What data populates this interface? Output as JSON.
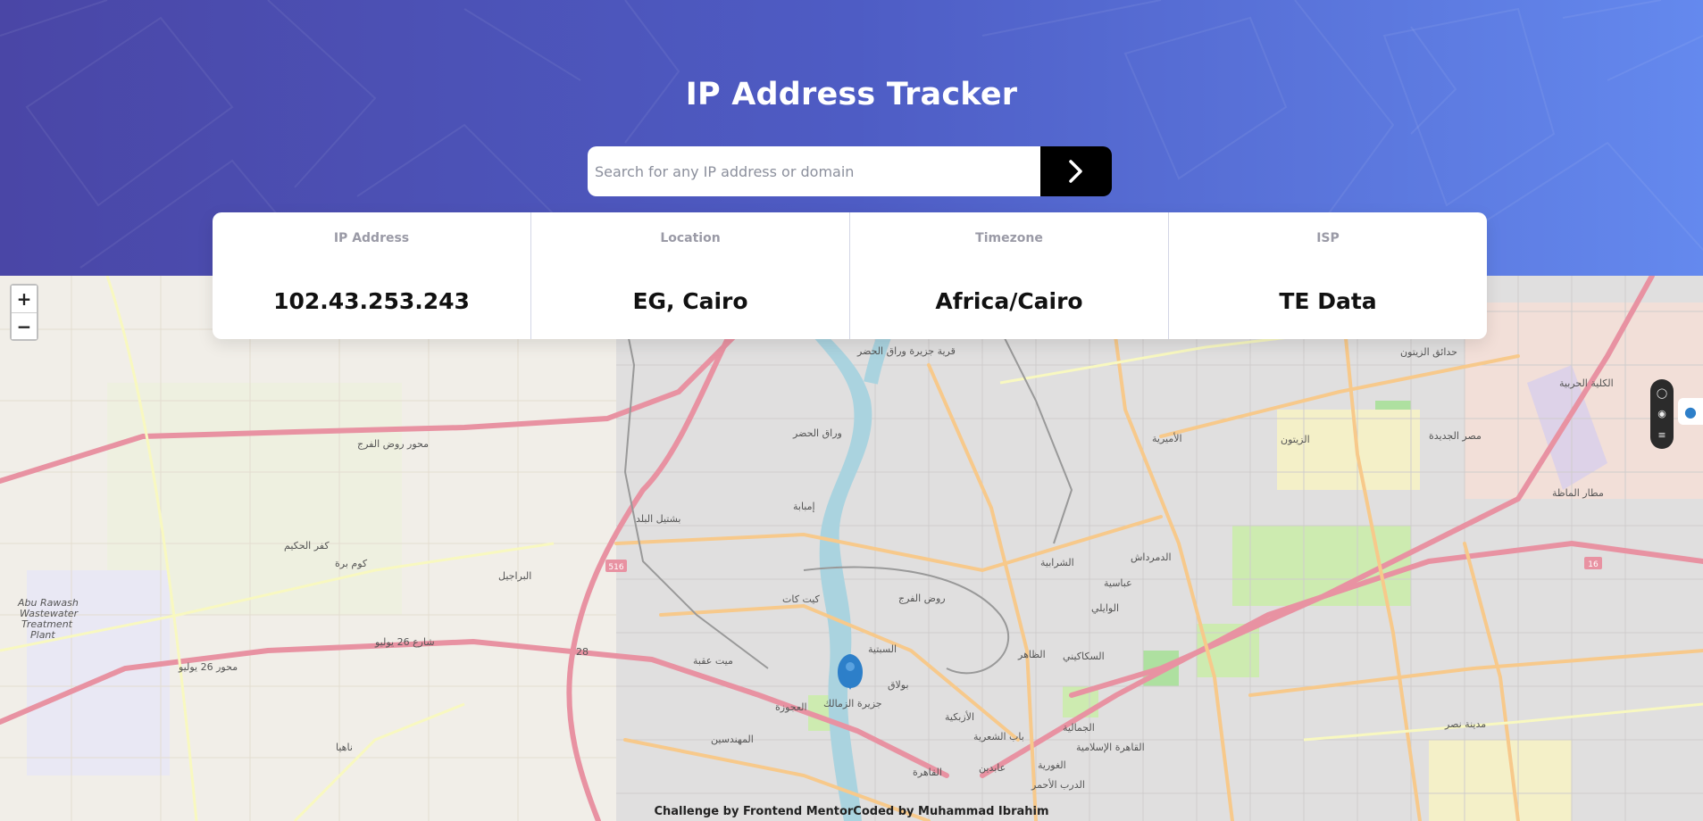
{
  "header": {
    "title": "IP Address Tracker",
    "background_colors": [
      "#4a46a6",
      "#6489ee"
    ]
  },
  "search": {
    "placeholder": "Search for any IP address or domain",
    "value": "",
    "button_icon": "chevron-right-icon"
  },
  "info": {
    "ip": {
      "label": "IP Address",
      "value": "102.43.253.243"
    },
    "location": {
      "label": "Location",
      "value": "EG, Cairo"
    },
    "timezone": {
      "label": "Timezone",
      "value": "Africa/Cairo"
    },
    "isp": {
      "label": "ISP",
      "value": "TE Data"
    }
  },
  "map": {
    "zoom_in": "+",
    "zoom_out": "−",
    "marker_icon": "location-pin-icon",
    "place_labels": [
      "قرية جزيرة وراق الحضر",
      "وراق الحضر",
      "إمبابة",
      "بشتيل البلد",
      "كفر الحكيم",
      "كوم برة",
      "البراجيل",
      "كيت كات",
      "روض الفرج",
      "ميت عقبة",
      "بولاق",
      "السبتية",
      "العجوزة",
      "المهندسين",
      "جزيرة الزمالك",
      "الأزبكية",
      "باب الشعرية",
      "الظاهر",
      "السكاكيني",
      "الوايلي",
      "عباسية",
      "الشرابية",
      "الدمرداش",
      "الأميرية",
      "الزيتون",
      "حدائق الزيتون",
      "مصر الجديدة",
      "الكلية الحربية",
      "مطار الماظة",
      "مدينة نصر",
      "القاهرة",
      "عابدين",
      "الجمالية",
      "القاهرة الإسلامية",
      "الغورية",
      "الدرب الأحمر",
      "ناهيا",
      "Abu Rawash",
      "Wastewater",
      "Treatment",
      "Plant"
    ],
    "road_labels": [
      "محور روض الفرج",
      "محور 26 يوليو",
      "شارع 26 يوليو"
    ],
    "route_shields": [
      "516",
      "16",
      "28"
    ]
  },
  "footer": {
    "text": "Challenge by Frontend MentorCoded by Muhammad Ibrahim"
  }
}
